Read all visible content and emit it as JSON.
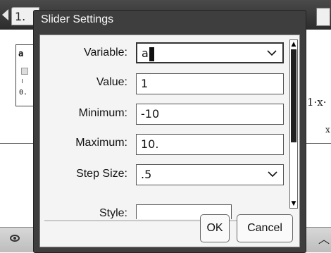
{
  "document": {
    "page_tab": "1.",
    "slider_widget": {
      "variable": "a",
      "min_label": "0."
    },
    "expression_partial": "1·x·",
    "xlabel_partial": "x"
  },
  "dialog": {
    "title": "Slider Settings",
    "fields": {
      "variable": {
        "label": "Variable:",
        "value": "a"
      },
      "value": {
        "label": "Value:",
        "value": "1"
      },
      "minimum": {
        "label": "Minimum:",
        "value": "-10"
      },
      "maximum": {
        "label": "Maximum:",
        "value": "10."
      },
      "step_size": {
        "label": "Step Size:",
        "value": ".5"
      },
      "style": {
        "label": "Style:"
      }
    },
    "buttons": {
      "ok": "OK",
      "cancel": "Cancel"
    }
  },
  "icons": {
    "back": "back-arrow-icon",
    "dropdown": "chevron-down-icon",
    "scroll_up": "scroll-up-icon",
    "scroll_down": "scroll-down-icon",
    "eye": "eye-icon",
    "collapse": "chevron-up-icon"
  }
}
